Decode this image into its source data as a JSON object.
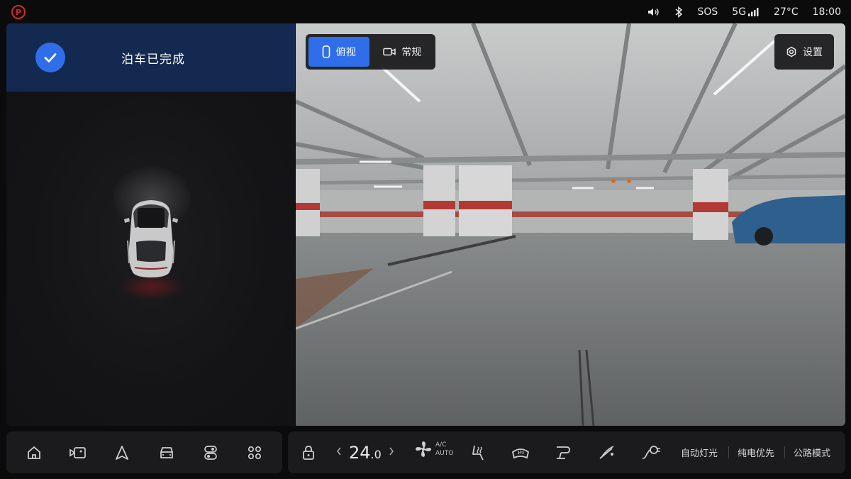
{
  "status": {
    "sos": "SOS",
    "network": "5G",
    "temperature": "27°C",
    "time": "18:00"
  },
  "parking": {
    "message": "泊车已完成"
  },
  "camera": {
    "views": [
      {
        "label": "俯视",
        "active": true
      },
      {
        "label": "常规",
        "active": false
      }
    ],
    "settings_label": "设置"
  },
  "dock": {
    "temperature_main": "24",
    "temperature_decimal": ".0",
    "ac_label": "A/C",
    "ac_mode": "AUTO",
    "modes": [
      "自动灯光",
      "纯电优先",
      "公路模式"
    ]
  },
  "colors": {
    "accent": "#2f6ee8",
    "banner": "#14294f",
    "park_indicator": "#d2282c"
  }
}
